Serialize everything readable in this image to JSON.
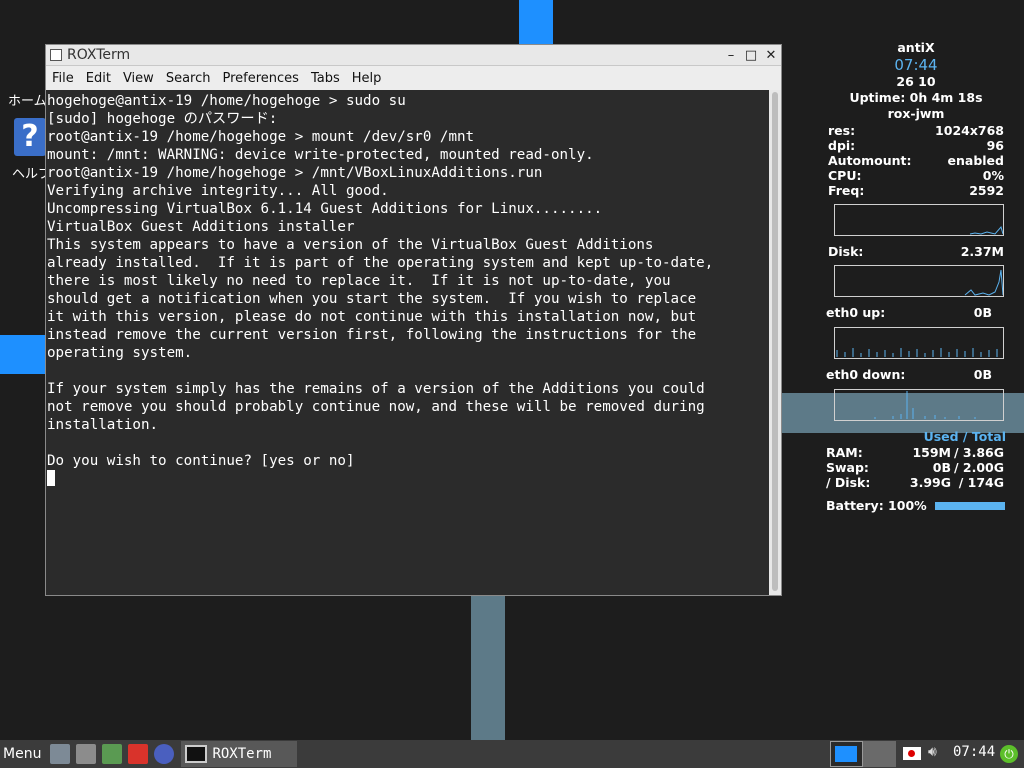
{
  "desktop": {
    "home_label": "ホーム",
    "help_icon": "?",
    "help_label": "ヘルプ"
  },
  "conky": {
    "distro": "antiX",
    "time": "07:44",
    "date": "26 10",
    "uptime": "Uptime: 0h 4m 18s",
    "wm": "rox-jwm",
    "res_label": "res:",
    "res": "1024x768",
    "dpi_label": "dpi:",
    "dpi": "96",
    "automount_label": "Automount:",
    "automount": "enabled",
    "cpu_label": "CPU:",
    "cpu": "0%",
    "freq_label": "Freq:",
    "freq": "2592",
    "disk_label": "Disk:",
    "disk": "2.37M",
    "eth_up_label": "eth0 up:",
    "eth_up": "0B",
    "eth_down_label": "eth0 down:",
    "eth_down": "0B",
    "used_total": "Used / Total",
    "ram_label": "RAM:",
    "ram_used": "159M",
    "ram_total": "/ 3.86G",
    "swap_label": "Swap:",
    "swap_used": "0B",
    "swap_total": "/ 2.00G",
    "disk_root_label": "/ Disk:",
    "disk_root_used": "3.99G",
    "disk_root_total": "/ 174G",
    "battery": "Battery: 100%",
    "battery_level": 1.0,
    "accent_color": "#5bb3f0"
  },
  "window": {
    "title": "ROXTerm",
    "controls": {
      "minimize": "–",
      "maximize": "□",
      "close": "✕"
    },
    "menu": [
      "File",
      "Edit",
      "View",
      "Search",
      "Preferences",
      "Tabs",
      "Help"
    ],
    "terminal_lines": [
      "hogehoge@antix-19 /home/hogehoge > sudo su",
      "[sudo] hogehoge のパスワード:",
      "root@antix-19 /home/hogehoge > mount /dev/sr0 /mnt",
      "mount: /mnt: WARNING: device write-protected, mounted read-only.",
      "root@antix-19 /home/hogehoge > /mnt/VBoxLinuxAdditions.run",
      "Verifying archive integrity... All good.",
      "Uncompressing VirtualBox 6.1.14 Guest Additions for Linux........",
      "VirtualBox Guest Additions installer",
      "This system appears to have a version of the VirtualBox Guest Additions",
      "already installed.  If it is part of the operating system and kept up-to-date,",
      "there is most likely no need to replace it.  If it is not up-to-date, you",
      "should get a notification when you start the system.  If you wish to replace",
      "it with this version, please do not continue with this installation now, but",
      "instead remove the current version first, following the instructions for the",
      "operating system.",
      "",
      "If your system simply has the remains of a version of the Additions you could",
      "not remove you should probably continue now, and these will be removed during",
      "installation.",
      "",
      "Do you wish to continue? [yes or no]"
    ]
  },
  "taskbar": {
    "menu_label": "Menu",
    "task_label": "ROXTerm",
    "clock": "07:44",
    "launchers": [
      "file-manager-icon",
      "trash-icon",
      "text-editor-icon",
      "folder-icon",
      "browser-icon"
    ]
  }
}
